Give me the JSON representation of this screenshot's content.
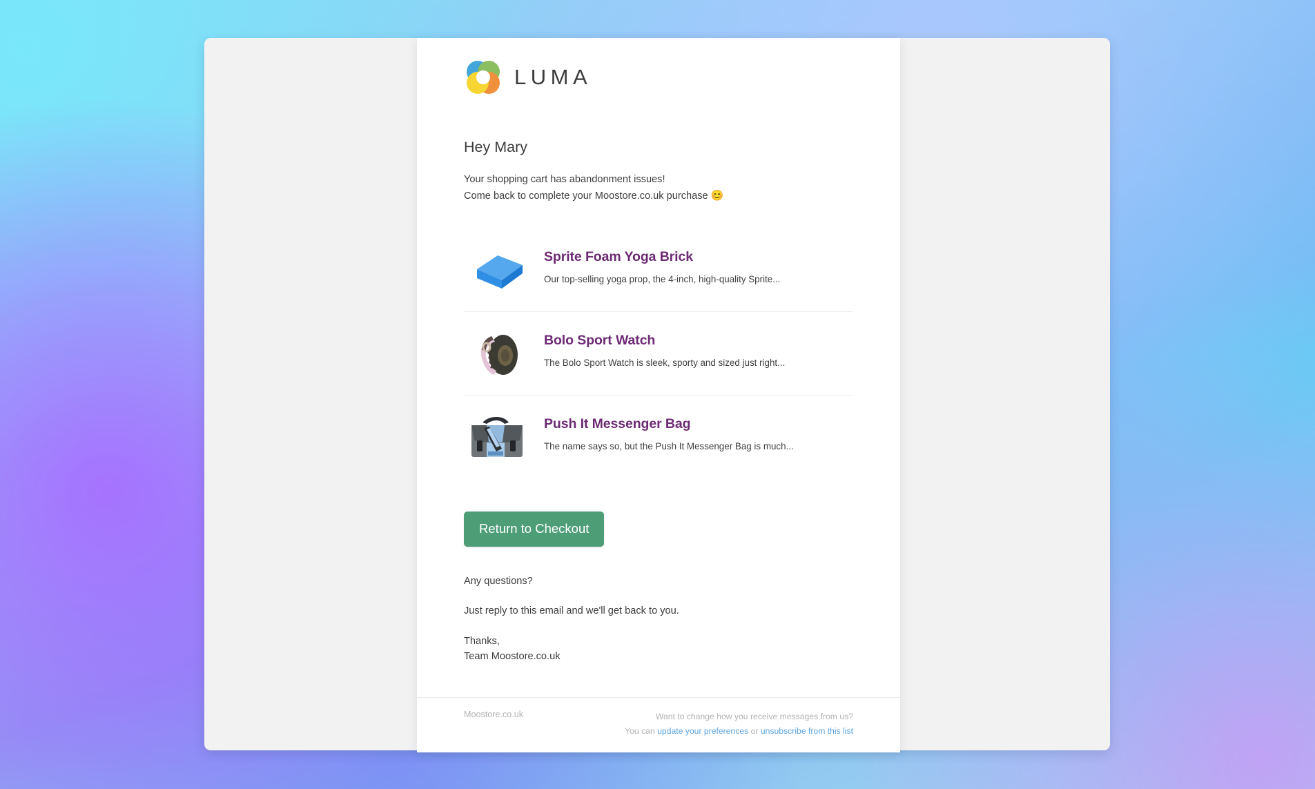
{
  "brand": {
    "logo_icon": "luma-logo-icon",
    "wordmark": "LUMA",
    "logo_colors": {
      "blue": "#2a9ad6",
      "green": "#7ab648",
      "orange": "#ef8022",
      "yellow": "#f7d117"
    }
  },
  "email": {
    "greeting": "Hey Mary",
    "intro_line_1": "Your shopping cart has abandonment issues!",
    "intro_line_2": "Come back to complete your Moostore.co.uk purchase",
    "intro_emoji": "😊",
    "products": [
      {
        "title": "Sprite Foam Yoga Brick",
        "description": "Our top-selling yoga prop, the 4-inch, high-quality Sprite...",
        "image_icon": "yoga-brick-image",
        "colors": {
          "top": "#55a8ee",
          "front": "#2f8fe4",
          "side": "#1d7ad0"
        }
      },
      {
        "title": "Bolo Sport Watch",
        "description": "The Bolo Sport Watch is sleek, sporty and sized just right...",
        "image_icon": "sport-watch-image",
        "colors": {
          "body": "#3b3a33",
          "strap": "#e3c3d6",
          "dial": "#6d6148"
        }
      },
      {
        "title": "Push It Messenger Bag",
        "description": "The name says so, but the Push It Messenger Bag is much...",
        "image_icon": "messenger-bag-image",
        "colors": {
          "body": "#6f7478",
          "panel": "#a9cbea",
          "trim": "#2c2f33"
        }
      }
    ],
    "cta_label": "Return to Checkout",
    "closing_1": "Any questions?",
    "closing_2": "Just reply to this email and we'll get back to you.",
    "closing_3_line_1": "Thanks,",
    "closing_3_line_2": "Team Moostore.co.uk",
    "accent_title_color": "#6d2a74",
    "cta_color": "#4d9e77"
  },
  "footer": {
    "brand": "Moostore.co.uk",
    "line_1": "Want to change how you receive messages from us?",
    "line_2_prefix": "You can ",
    "link_preferences": "update your preferences",
    "line_2_middle": " or ",
    "link_unsubscribe": "unsubscribe from this list",
    "link_color": "#5aa4df"
  }
}
